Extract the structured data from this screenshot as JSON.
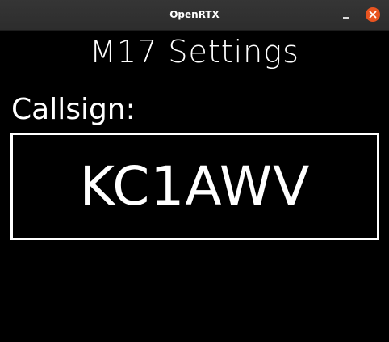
{
  "window": {
    "title": "OpenRTX"
  },
  "screen": {
    "menu_title": "M17 Settings",
    "field_label": "Callsign:",
    "callsign_value": "KC1AWV"
  },
  "colors": {
    "background": "#000000",
    "foreground": "#ffffff",
    "close_button": "#e95420",
    "titlebar": "#2d2d2d"
  },
  "icons": {
    "minimize": "minimize-icon",
    "close": "close-icon"
  }
}
